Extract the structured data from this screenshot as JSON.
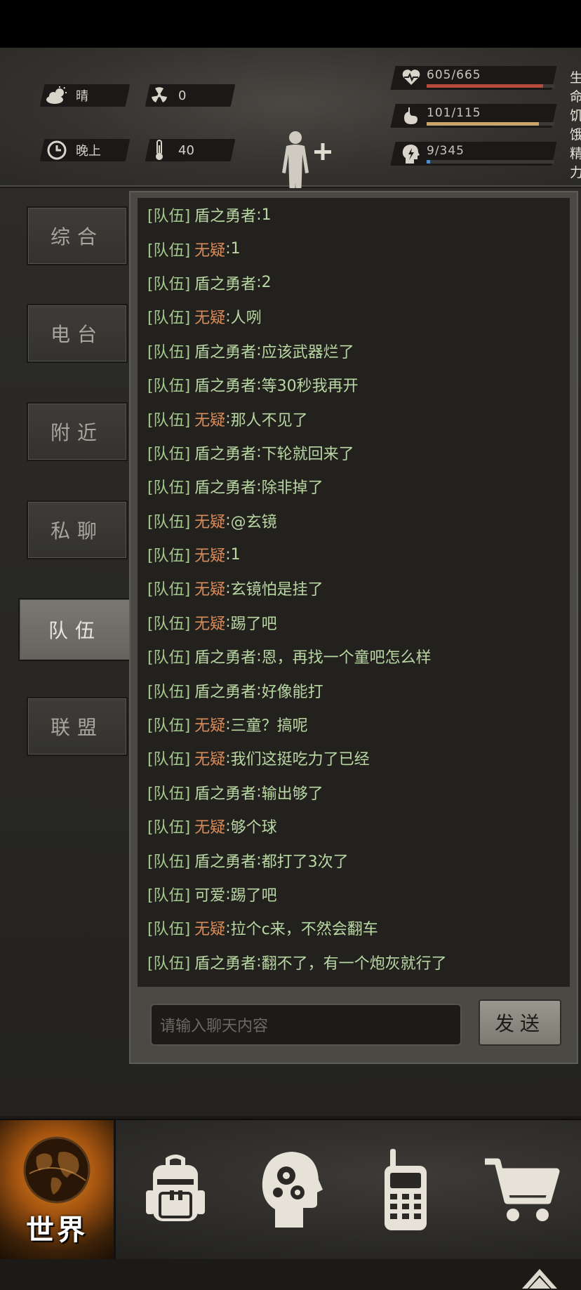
{
  "status": {
    "weather": "晴",
    "radiation": "0",
    "time_of_day": "晚上",
    "temperature": "40",
    "hp": {
      "text": "605/665",
      "label": "生命",
      "fraction": 0.91,
      "color": "#b54a3f"
    },
    "hunger": {
      "text": "101/115",
      "label": "饥饿",
      "fraction": 0.88,
      "color": "#c9a56a"
    },
    "energy": {
      "text": "9/345",
      "label": "精力",
      "fraction": 0.03,
      "color": "#4f8fd0"
    }
  },
  "tabs": [
    "综合",
    "电台",
    "附近",
    "私聊",
    "队伍",
    "联盟"
  ],
  "active_tab": "队伍",
  "chat": {
    "messages": [
      {
        "channel": "[队伍]",
        "name": "盾之勇者",
        "color": "green",
        "text": "1"
      },
      {
        "channel": "[队伍]",
        "name": "无疑",
        "color": "orange",
        "text": "1"
      },
      {
        "channel": "[队伍]",
        "name": "盾之勇者",
        "color": "green",
        "text": "2"
      },
      {
        "channel": "[队伍]",
        "name": "无疑",
        "color": "orange",
        "text": "人咧"
      },
      {
        "channel": "[队伍]",
        "name": "盾之勇者",
        "color": "green",
        "text": "应该武器烂了"
      },
      {
        "channel": "[队伍]",
        "name": "盾之勇者",
        "color": "green",
        "text": "等30秒我再开"
      },
      {
        "channel": "[队伍]",
        "name": "无疑",
        "color": "orange",
        "text": "那人不见了"
      },
      {
        "channel": "[队伍]",
        "name": "盾之勇者",
        "color": "green",
        "text": "下轮就回来了"
      },
      {
        "channel": "[队伍]",
        "name": "盾之勇者",
        "color": "green",
        "text": "除非掉了"
      },
      {
        "channel": "[队伍]",
        "name": "无疑",
        "color": "orange",
        "text": "@玄镜"
      },
      {
        "channel": "[队伍]",
        "name": "无疑",
        "color": "orange",
        "text": "1"
      },
      {
        "channel": "[队伍]",
        "name": "无疑",
        "color": "orange",
        "text": "玄镜怕是挂了"
      },
      {
        "channel": "[队伍]",
        "name": "无疑",
        "color": "orange",
        "text": "踢了吧"
      },
      {
        "channel": "[队伍]",
        "name": "盾之勇者",
        "color": "green",
        "text": "恩，再找一个童吧怎么样"
      },
      {
        "channel": "[队伍]",
        "name": "盾之勇者",
        "color": "green",
        "text": "好像能打"
      },
      {
        "channel": "[队伍]",
        "name": "无疑",
        "color": "orange",
        "text": "三童？搞呢"
      },
      {
        "channel": "[队伍]",
        "name": "无疑",
        "color": "orange",
        "text": "我们这挺吃力了已经"
      },
      {
        "channel": "[队伍]",
        "name": "盾之勇者",
        "color": "green",
        "text": "输出够了"
      },
      {
        "channel": "[队伍]",
        "name": "无疑",
        "color": "orange",
        "text": "够个球"
      },
      {
        "channel": "[队伍]",
        "name": "盾之勇者",
        "color": "green",
        "text": "都打了3次了"
      },
      {
        "channel": "[队伍]",
        "name": "可爱",
        "color": "green",
        "text": "踢了吧"
      },
      {
        "channel": "[队伍]",
        "name": "无疑",
        "color": "orange",
        "text": "拉个c来，不然会翻车"
      },
      {
        "channel": "[队伍]",
        "name": "盾之勇者",
        "color": "green",
        "text": "翻不了，有一个炮灰就行了"
      }
    ],
    "input_placeholder": "请输入聊天内容",
    "send_label": "发送"
  },
  "bottom_nav": {
    "world_label": "世界",
    "items": [
      "globe-icon",
      "backpack-icon",
      "brain-icon",
      "walkie-talkie-icon",
      "cart-icon"
    ]
  }
}
